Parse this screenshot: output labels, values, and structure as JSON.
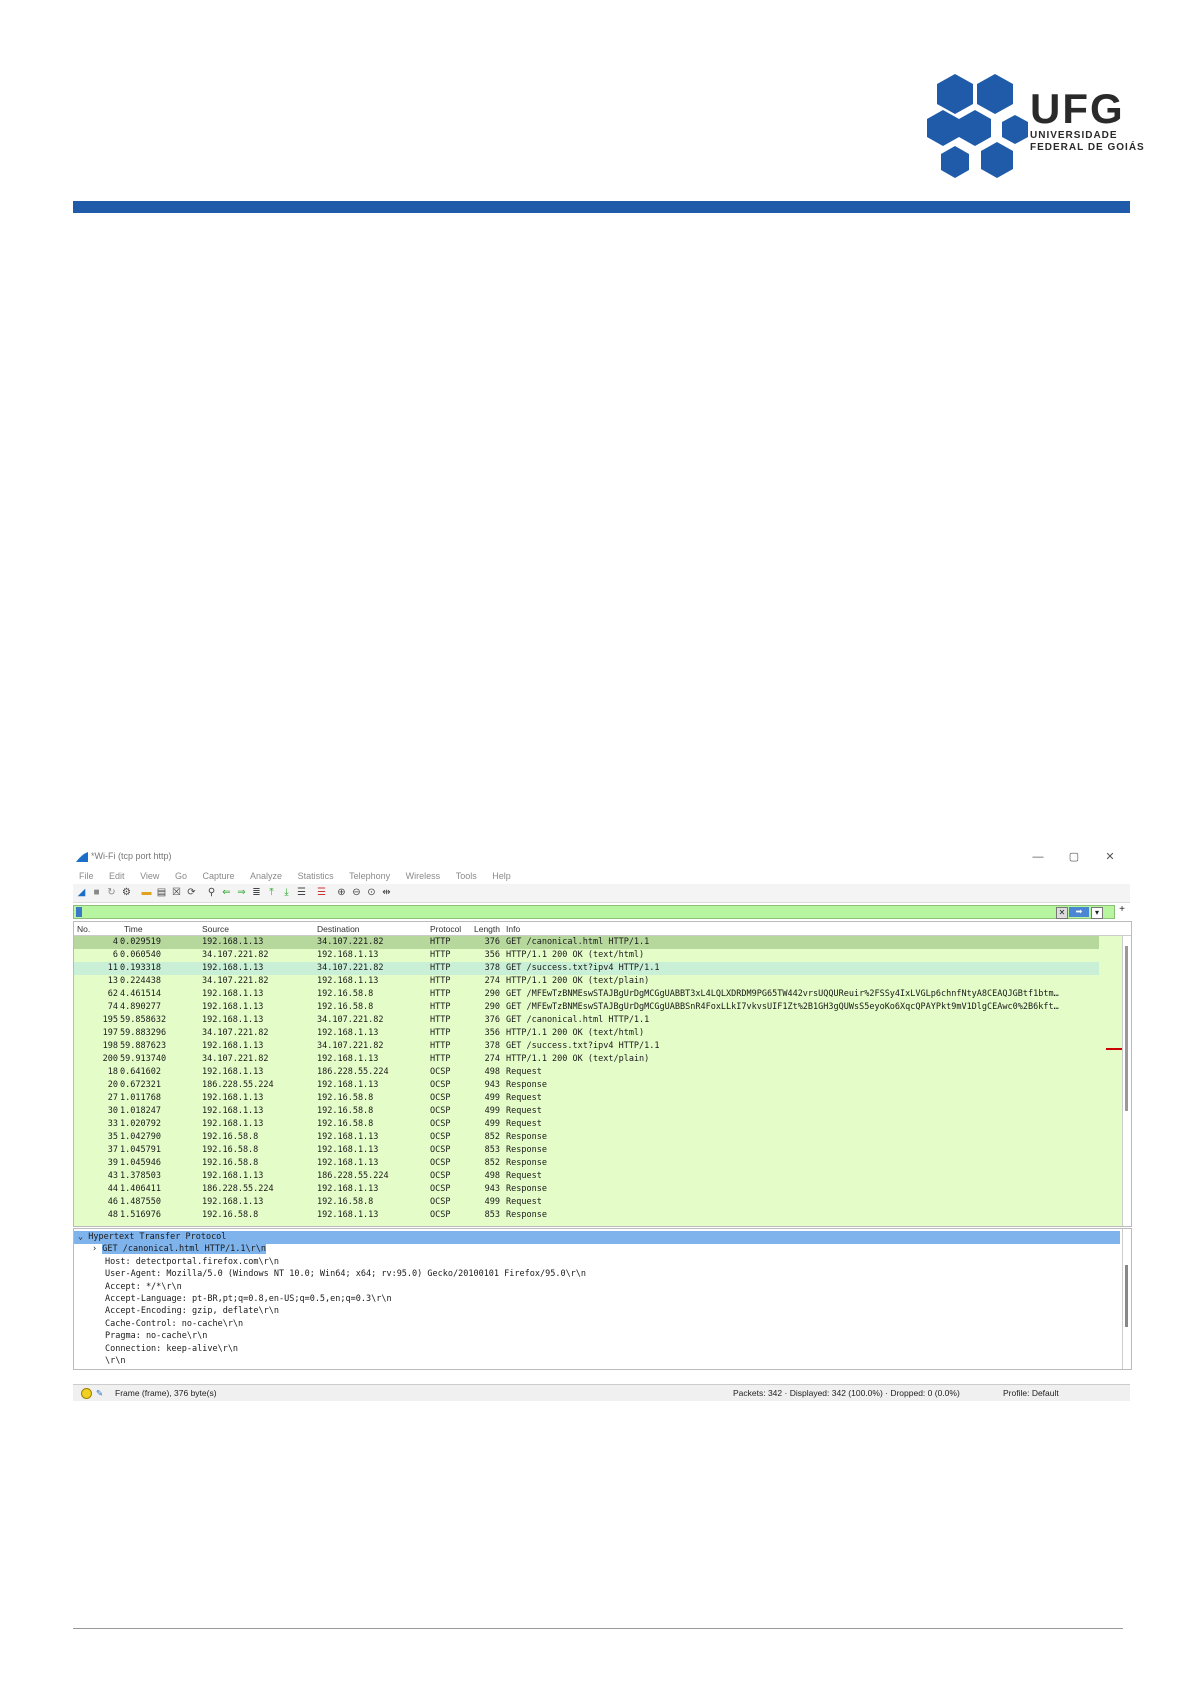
{
  "header": {
    "logo_title": "UFG",
    "logo_line1": "UNIVERSIDADE",
    "logo_line2": "FEDERAL DE GOIÁS",
    "bar_color": "#1f5ba8"
  },
  "window": {
    "title": "*Wi-Fi (tcp port http)",
    "minimize": "—",
    "maximize": "▢",
    "close": "✕"
  },
  "menu": [
    "File",
    "Edit",
    "View",
    "Go",
    "Capture",
    "Analyze",
    "Statistics",
    "Telephony",
    "Wireless",
    "Tools",
    "Help"
  ],
  "filter": {
    "value": "",
    "plus": "+"
  },
  "columns": {
    "no": "No.",
    "time": "Time",
    "source": "Source",
    "destination": "Destination",
    "protocol": "Protocol",
    "length": "Length",
    "info": "Info"
  },
  "packets": [
    {
      "no": "4",
      "time": "0.029519",
      "src": "192.168.1.13",
      "dst": "34.107.221.82",
      "proto": "HTTP",
      "len": "376",
      "info": "GET /canonical.html HTTP/1.1"
    },
    {
      "no": "6",
      "time": "0.060540",
      "src": "34.107.221.82",
      "dst": "192.168.1.13",
      "proto": "HTTP",
      "len": "356",
      "info": "HTTP/1.1 200 OK  (text/html)"
    },
    {
      "no": "11",
      "time": "0.193318",
      "src": "192.168.1.13",
      "dst": "34.107.221.82",
      "proto": "HTTP",
      "len": "378",
      "info": "GET /success.txt?ipv4 HTTP/1.1"
    },
    {
      "no": "13",
      "time": "0.224438",
      "src": "34.107.221.82",
      "dst": "192.168.1.13",
      "proto": "HTTP",
      "len": "274",
      "info": "HTTP/1.1 200 OK  (text/plain)"
    },
    {
      "no": "62",
      "time": "4.461514",
      "src": "192.168.1.13",
      "dst": "192.16.58.8",
      "proto": "HTTP",
      "len": "290",
      "info": "GET /MFEwTzBNMEswSTAJBgUrDgMCGgUABBT3xL4LQLXDRDM9PG65TW442vrsUQQUReuir%2FSSy4IxLVGLp6chnfNtyA8CEAQJGBtf1btm…"
    },
    {
      "no": "74",
      "time": "4.890277",
      "src": "192.168.1.13",
      "dst": "192.16.58.8",
      "proto": "HTTP",
      "len": "290",
      "info": "GET /MFEwTzBNMEswSTAJBgUrDgMCGgUABBSnR4FoxLLkI7vkvsUIF1Zt%2B1GH3gQUWsS5eyoKo6XqcQPAYPkt9mV1DlgCEAwc0%2B6kft…"
    },
    {
      "no": "195",
      "time": "59.858632",
      "src": "192.168.1.13",
      "dst": "34.107.221.82",
      "proto": "HTTP",
      "len": "376",
      "info": "GET /canonical.html HTTP/1.1"
    },
    {
      "no": "197",
      "time": "59.883296",
      "src": "34.107.221.82",
      "dst": "192.168.1.13",
      "proto": "HTTP",
      "len": "356",
      "info": "HTTP/1.1 200 OK  (text/html)"
    },
    {
      "no": "198",
      "time": "59.887623",
      "src": "192.168.1.13",
      "dst": "34.107.221.82",
      "proto": "HTTP",
      "len": "378",
      "info": "GET /success.txt?ipv4 HTTP/1.1"
    },
    {
      "no": "200",
      "time": "59.913740",
      "src": "34.107.221.82",
      "dst": "192.168.1.13",
      "proto": "HTTP",
      "len": "274",
      "info": "HTTP/1.1 200 OK  (text/plain)"
    },
    {
      "no": "18",
      "time": "0.641602",
      "src": "192.168.1.13",
      "dst": "186.228.55.224",
      "proto": "OCSP",
      "len": "498",
      "info": "Request"
    },
    {
      "no": "20",
      "time": "0.672321",
      "src": "186.228.55.224",
      "dst": "192.168.1.13",
      "proto": "OCSP",
      "len": "943",
      "info": "Response"
    },
    {
      "no": "27",
      "time": "1.011768",
      "src": "192.168.1.13",
      "dst": "192.16.58.8",
      "proto": "OCSP",
      "len": "499",
      "info": "Request"
    },
    {
      "no": "30",
      "time": "1.018247",
      "src": "192.168.1.13",
      "dst": "192.16.58.8",
      "proto": "OCSP",
      "len": "499",
      "info": "Request"
    },
    {
      "no": "33",
      "time": "1.020792",
      "src": "192.168.1.13",
      "dst": "192.16.58.8",
      "proto": "OCSP",
      "len": "499",
      "info": "Request"
    },
    {
      "no": "35",
      "time": "1.042790",
      "src": "192.16.58.8",
      "dst": "192.168.1.13",
      "proto": "OCSP",
      "len": "852",
      "info": "Response"
    },
    {
      "no": "37",
      "time": "1.045791",
      "src": "192.16.58.8",
      "dst": "192.168.1.13",
      "proto": "OCSP",
      "len": "853",
      "info": "Response"
    },
    {
      "no": "39",
      "time": "1.045946",
      "src": "192.16.58.8",
      "dst": "192.168.1.13",
      "proto": "OCSP",
      "len": "852",
      "info": "Response"
    },
    {
      "no": "43",
      "time": "1.378503",
      "src": "192.168.1.13",
      "dst": "186.228.55.224",
      "proto": "OCSP",
      "len": "498",
      "info": "Request"
    },
    {
      "no": "44",
      "time": "1.406411",
      "src": "186.228.55.224",
      "dst": "192.168.1.13",
      "proto": "OCSP",
      "len": "943",
      "info": "Response"
    },
    {
      "no": "46",
      "time": "1.487550",
      "src": "192.168.1.13",
      "dst": "192.16.58.8",
      "proto": "OCSP",
      "len": "499",
      "info": "Request"
    },
    {
      "no": "48",
      "time": "1.516976",
      "src": "192.16.58.8",
      "dst": "192.168.1.13",
      "proto": "OCSP",
      "len": "853",
      "info": "Response"
    }
  ],
  "details": [
    "Hypertext Transfer Protocol",
    "GET /canonical.html HTTP/1.1\\r\\n",
    "Host: detectportal.firefox.com\\r\\n",
    "User-Agent: Mozilla/5.0 (Windows NT 10.0; Win64; x64; rv:95.0) Gecko/20100101 Firefox/95.0\\r\\n",
    "Accept: */*\\r\\n",
    "Accept-Language: pt-BR,pt;q=0.8,en-US;q=0.5,en;q=0.3\\r\\n",
    "Accept-Encoding: gzip, deflate\\r\\n",
    "Cache-Control: no-cache\\r\\n",
    "Pragma: no-cache\\r\\n",
    "Connection: keep-alive\\r\\n",
    "\\r\\n"
  ],
  "status": {
    "frame": "Frame (frame), 376 byte(s)",
    "packets": "Packets: 342 · Displayed: 342 (100.0%) · Dropped: 0 (0.0%)",
    "profile": "Profile: Default"
  },
  "colors": {
    "row_bg": "#e4fcc8",
    "row_selected": "#b6d89c",
    "row_highlight": "#c9efd6",
    "detail_selected": "#7fb3ec"
  }
}
